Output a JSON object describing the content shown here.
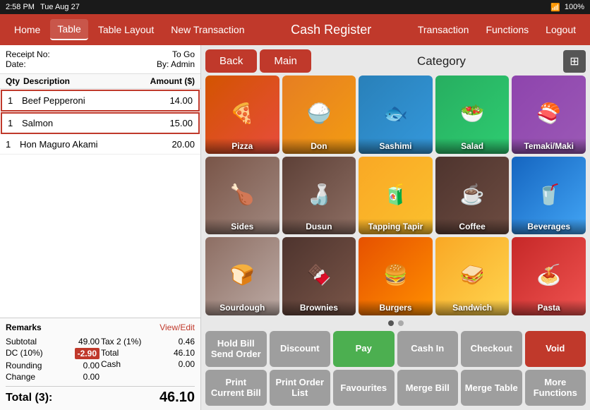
{
  "statusBar": {
    "time": "2:58 PM",
    "day": "Tue Aug 27",
    "wifi": "WiFi",
    "battery": "100%"
  },
  "topNav": {
    "title": "Cash Register",
    "items": [
      "Home",
      "Table",
      "Table Layout",
      "New Transaction"
    ],
    "rightItems": [
      "Transaction",
      "Functions",
      "Logout"
    ]
  },
  "receipt": {
    "receiptLabel": "Receipt No:",
    "dateLabel": "Date:",
    "toGoLabel": "To Go",
    "byLabel": "By: Admin",
    "columns": {
      "qty": "Qty",
      "description": "Description",
      "amount": "Amount ($)"
    },
    "items": [
      {
        "qty": "1",
        "description": "Beef Pepperoni",
        "amount": "14.00",
        "selected": true
      },
      {
        "qty": "1",
        "description": "Salmon",
        "amount": "15.00",
        "selected": true
      },
      {
        "qty": "1",
        "description": "Hon Maguro Akami",
        "amount": "20.00",
        "selected": false
      }
    ],
    "remarks": "Remarks",
    "viewEdit": "View/Edit",
    "subtotalLabel": "Subtotal",
    "subtotalValue": "49.00",
    "tax2Label": "Tax 2 (1%)",
    "tax2Value": "0.46",
    "dcLabel": "DC (10%)",
    "dcValue": "-2.90",
    "totalLabel": "Total",
    "totalValue": "46.10",
    "roundingLabel": "Rounding",
    "roundingValue": "0.00",
    "cashLabel": "Cash",
    "cashValue": "0.00",
    "changeLabel": "Change",
    "changeValue": "0.00",
    "totalFull": "Total (3):",
    "totalFinalValue": "46.10"
  },
  "rightPanel": {
    "backLabel": "Back",
    "mainLabel": "Main",
    "categoryLabel": "Category",
    "categories": [
      {
        "name": "Pizza",
        "emoji": "🍕",
        "cssClass": "cat-pizza"
      },
      {
        "name": "Don",
        "emoji": "🍚",
        "cssClass": "cat-don"
      },
      {
        "name": "Sashimi",
        "emoji": "🐟",
        "cssClass": "cat-sashimi"
      },
      {
        "name": "Salad",
        "emoji": "🥗",
        "cssClass": "cat-salad"
      },
      {
        "name": "Temaki/Maki",
        "emoji": "🍣",
        "cssClass": "cat-temaki"
      },
      {
        "name": "Sides",
        "emoji": "🍗",
        "cssClass": "cat-sides"
      },
      {
        "name": "Dusun",
        "emoji": "🍶",
        "cssClass": "cat-dusun"
      },
      {
        "name": "Tapping Tapir",
        "emoji": "🧃",
        "cssClass": "cat-tapping"
      },
      {
        "name": "Coffee",
        "emoji": "☕",
        "cssClass": "cat-coffee"
      },
      {
        "name": "Beverages",
        "emoji": "🥤",
        "cssClass": "cat-beverages"
      },
      {
        "name": "Sourdough",
        "emoji": "🍞",
        "cssClass": "cat-sourdough"
      },
      {
        "name": "Brownies",
        "emoji": "🍫",
        "cssClass": "cat-brownies"
      },
      {
        "name": "Burgers",
        "emoji": "🍔",
        "cssClass": "cat-burgers"
      },
      {
        "name": "Sandwich",
        "emoji": "🥪",
        "cssClass": "cat-sandwich"
      },
      {
        "name": "Pasta",
        "emoji": "🍝",
        "cssClass": "cat-pasta"
      }
    ],
    "actions": [
      {
        "label": "Hold Bill\nSend Order",
        "type": "gray"
      },
      {
        "label": "Discount",
        "type": "gray"
      },
      {
        "label": "Pay",
        "type": "green"
      },
      {
        "label": "Cash In",
        "type": "gray"
      },
      {
        "label": "Checkout",
        "type": "gray"
      },
      {
        "label": "Void",
        "type": "red"
      }
    ],
    "footerActions": [
      {
        "label": "Print Current Bill",
        "type": "gray"
      },
      {
        "label": "Print Order List",
        "type": "gray"
      },
      {
        "label": "Favourites",
        "type": "gray"
      },
      {
        "label": "Merge Bill",
        "type": "gray"
      },
      {
        "label": "Merge Table",
        "type": "gray"
      },
      {
        "label": "More Functions",
        "type": "gray"
      }
    ]
  }
}
